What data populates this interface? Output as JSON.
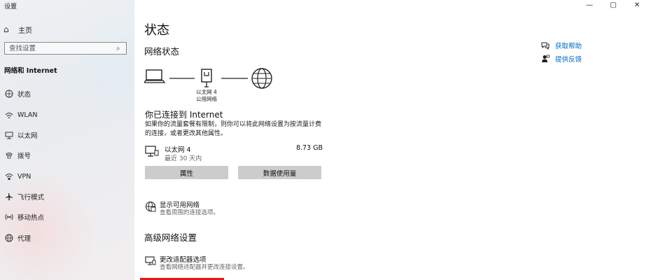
{
  "window": {
    "title": "设置",
    "controls": [
      "—",
      "▢",
      "✕"
    ]
  },
  "sidebar": {
    "home_label": "主页",
    "search_placeholder": "查找设置",
    "section_title": "网络和 Internet",
    "items": [
      {
        "label": "状态",
        "icon": "status-icon"
      },
      {
        "label": "WLAN",
        "icon": "wifi-icon"
      },
      {
        "label": "以太网",
        "icon": "ethernet-icon"
      },
      {
        "label": "拨号",
        "icon": "phone-icon"
      },
      {
        "label": "VPN",
        "icon": "vpn-icon"
      },
      {
        "label": "飞行模式",
        "icon": "airplane-icon"
      },
      {
        "label": "移动热点",
        "icon": "hotspot-icon"
      },
      {
        "label": "代理",
        "icon": "globe-icon"
      }
    ]
  },
  "main": {
    "page_title": "状态",
    "network_status_title": "网络状态",
    "diagram": {
      "adapter_label": "以太网 4",
      "network_label": "公用网络"
    },
    "connected_title": "你已连接到 Internet",
    "connected_desc": "如果你的流量套餐有限制，则你可以将此网络设置为按流量计费的连接，或者更改其他属性。",
    "adapter": {
      "name": "以太网 4",
      "period": "最近 30 天内",
      "usage": "8.73 GB"
    },
    "buttons": {
      "properties": "属性",
      "data_usage": "数据使用量"
    },
    "show_networks": {
      "title": "显示可用网络",
      "desc": "查看周围的连接选项。"
    },
    "advanced_title": "高级网络设置",
    "change_adapter": {
      "title": "更改适配器选项",
      "desc": "查看网络适配器并更改连接设置。"
    },
    "help": {
      "get_help": "获取帮助",
      "feedback": "提供反馈"
    }
  },
  "colors": {
    "accent": "#0067c0",
    "button_bg": "#cccccc"
  }
}
